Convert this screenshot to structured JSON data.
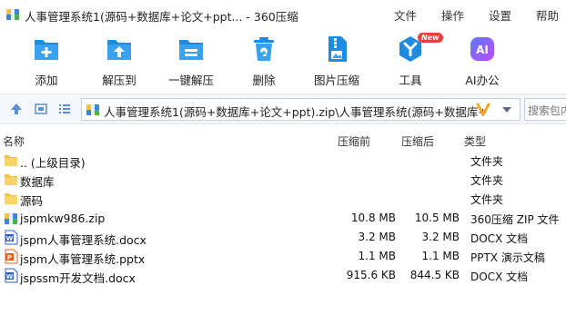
{
  "window": {
    "title": "人事管理系统1(源码+数据库+论文+ppt... - 360压缩",
    "menu": [
      "文件",
      "操作",
      "设置",
      "帮助"
    ]
  },
  "toolbar": {
    "items": [
      {
        "label": "添加",
        "icon": "add-icon"
      },
      {
        "label": "解压到",
        "icon": "extract-to-icon"
      },
      {
        "label": "一键解压",
        "icon": "one-click-extract-icon"
      },
      {
        "label": "删除",
        "icon": "delete-icon"
      },
      {
        "label": "图片压缩",
        "icon": "image-compress-icon"
      },
      {
        "label": "工具",
        "icon": "tools-icon",
        "badge": "New"
      },
      {
        "label": "AI办公",
        "icon": "ai-office-icon",
        "glyph": "AI"
      }
    ]
  },
  "address": {
    "path": "人事管理系统1(源码+数据库+论文+ppt).zip\\人事管理系统(源码+数据库+论文+ppt)",
    "search_placeholder": "搜索包内"
  },
  "columns": {
    "name": "名称",
    "compressed_before": "压缩前",
    "compressed_after": "压缩后",
    "type": "类型"
  },
  "files": [
    {
      "name": ".. (上级目录)",
      "before": "",
      "after": "",
      "type": "文件夹",
      "icon": "folder-icon"
    },
    {
      "name": "数据库",
      "before": "",
      "after": "",
      "type": "文件夹",
      "icon": "folder-icon"
    },
    {
      "name": "源码",
      "before": "",
      "after": "",
      "type": "文件夹",
      "icon": "folder-icon"
    },
    {
      "name": "jspmkw986.zip",
      "before": "10.8 MB",
      "after": "10.5 MB",
      "type": "360压缩 ZIP 文件",
      "icon": "zip-icon"
    },
    {
      "name": "jspm人事管理系统.docx",
      "before": "3.2 MB",
      "after": "3.2 MB",
      "type": "DOCX 文档",
      "icon": "word-icon"
    },
    {
      "name": "jspm人事管理系统.pptx",
      "before": "1.1 MB",
      "after": "1.1 MB",
      "type": "PPTX 演示文稿",
      "icon": "ppt-icon"
    },
    {
      "name": "jspssm开发文档.docx",
      "before": "915.6 KB",
      "after": "844.5 KB",
      "type": "DOCX 文档",
      "icon": "word-icon"
    }
  ],
  "colors": {
    "accent": "#1e8be0",
    "folder": "#f5c242",
    "word": "#2b5fc7",
    "ppt": "#e0622b",
    "arrow": "#f5a623"
  }
}
